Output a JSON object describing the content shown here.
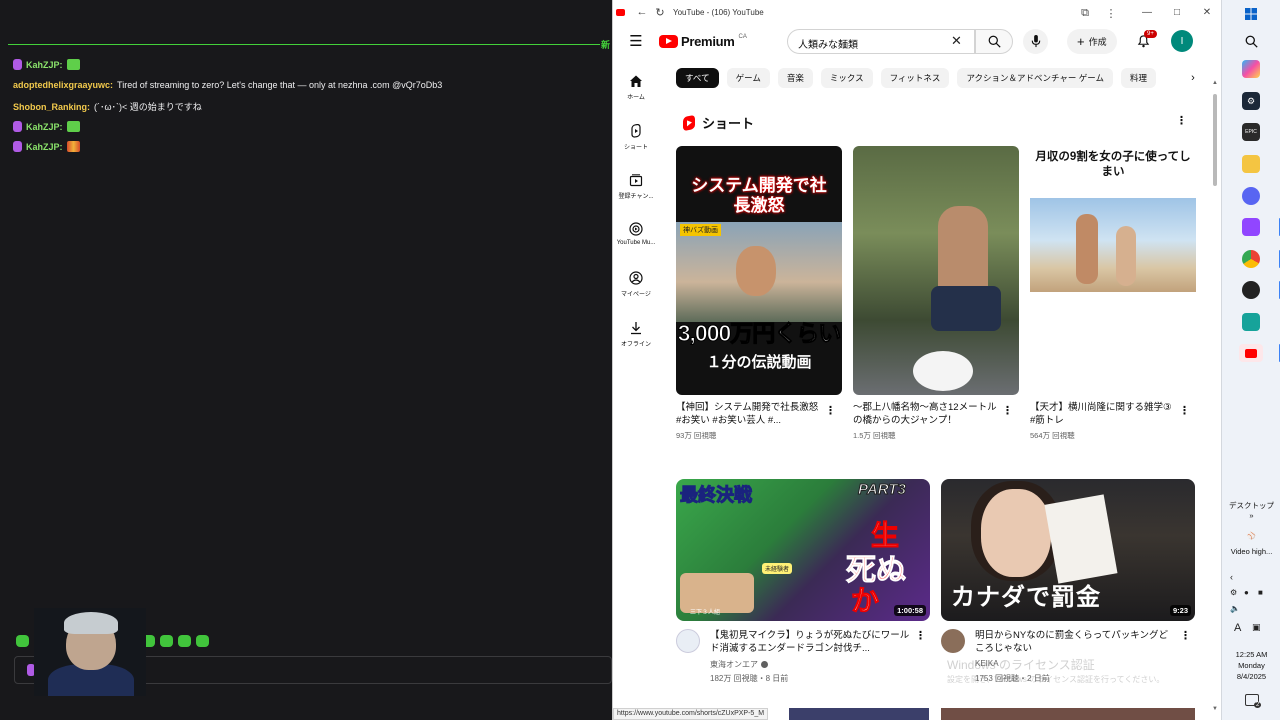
{
  "chat": {
    "new_label": "新",
    "messages": [
      {
        "user": "KahZJP:",
        "user_color": "#8be36b",
        "text": "",
        "emotes": [
          "green"
        ]
      },
      {
        "user": "adoptedhelixgraayuwc:",
        "user_color": "#f2c94c",
        "text": "Tired of streaming to zero? Let's change that — only at nezhna .com @vQr7oDb3",
        "emotes": []
      },
      {
        "user": "Shobon_Ranking:",
        "user_color": "#f2c94c",
        "text": "(´･ω･`)< 週の始まりですね",
        "emotes": []
      },
      {
        "user": "KahZJP:",
        "user_color": "#8be36b",
        "text": "",
        "emotes": [
          "green"
        ]
      },
      {
        "user": "KahZJP:",
        "user_color": "#8be36b",
        "text": "",
        "emotes": [
          "red"
        ]
      }
    ],
    "input_clear": "×"
  },
  "browser": {
    "title": "YouTube - (106) YouTube",
    "status_url": "https://www.youtube.com/shorts/cZUxPXP-5_M"
  },
  "youtube": {
    "logo_text": "Premium",
    "region": "CA",
    "search_value": "人類みな麺類",
    "create_label": "作成",
    "notif_badge": "9+",
    "avatar_letter": "I",
    "guide": [
      {
        "label": "ホーム",
        "icon": "home-icon"
      },
      {
        "label": "ショート",
        "icon": "shorts-icon"
      },
      {
        "label": "登録チャン...",
        "icon": "subscriptions-icon"
      },
      {
        "label": "YouTube Mu...",
        "icon": "music-icon"
      },
      {
        "label": "マイページ",
        "icon": "user-icon"
      },
      {
        "label": "オフライン",
        "icon": "download-icon"
      }
    ],
    "chips": [
      "すべて",
      "ゲーム",
      "音楽",
      "ミックス",
      "フィットネス",
      "アクション＆アドベンチャー ゲーム",
      "料理"
    ],
    "shorts_title": "ショート",
    "shorts": [
      {
        "title": "【神回】システム開発で社長激怒#お笑い #お笑い芸人 #...",
        "views": "93万 回視聴",
        "thumb_top": "システム開発で社長激怒",
        "thumb_tag": "神バズ動画",
        "thumb_mid": "3,000万円くらい",
        "thumb_bottom": "１分の伝説動画"
      },
      {
        "title": "〜郡上八幡名物〜高さ12メートルの橋からの大ジャンプ！",
        "views": "1.5万 回視聴"
      },
      {
        "title": "【天才】横川尚隆に関する雑学③ #筋トレ",
        "views": "564万 回視聴",
        "thumb_top": "月収の9割を女の子に使ってしまい"
      }
    ],
    "videos": [
      {
        "title": "【鬼初見マイクラ】りょうが死ぬたびにワールド消滅するエンダードラゴン討伐チ...",
        "channel": "東海オンエア",
        "stats": "182万 回視聴・8 日前",
        "duration": "1:00:58",
        "thumb_texts": [
          "最終決戦",
          "PART3",
          "生",
          "死ぬ",
          "か"
        ],
        "thumb_badge": "未経験者",
        "thumb_caption": "三下３人組"
      },
      {
        "title": "明日からNYなのに罰金くらってパッキングどころじゃない",
        "channel": "KEIKA",
        "stats": "1753 回視聴・2 日前",
        "duration": "9:23",
        "thumb_caption": "カナダで罰金"
      }
    ],
    "watermark_line1": "Windows のライセンス認証",
    "watermark_line2": "設定を開き、Windows のライセンス認証を行ってください。"
  },
  "taskbar": {
    "desktop_label": "デスクトップ",
    "desktop_sub": "»",
    "media_label": "Video high...",
    "time": "12:25 AM",
    "day": "Monday",
    "date": "8/4/2025",
    "notif_count": "2"
  }
}
